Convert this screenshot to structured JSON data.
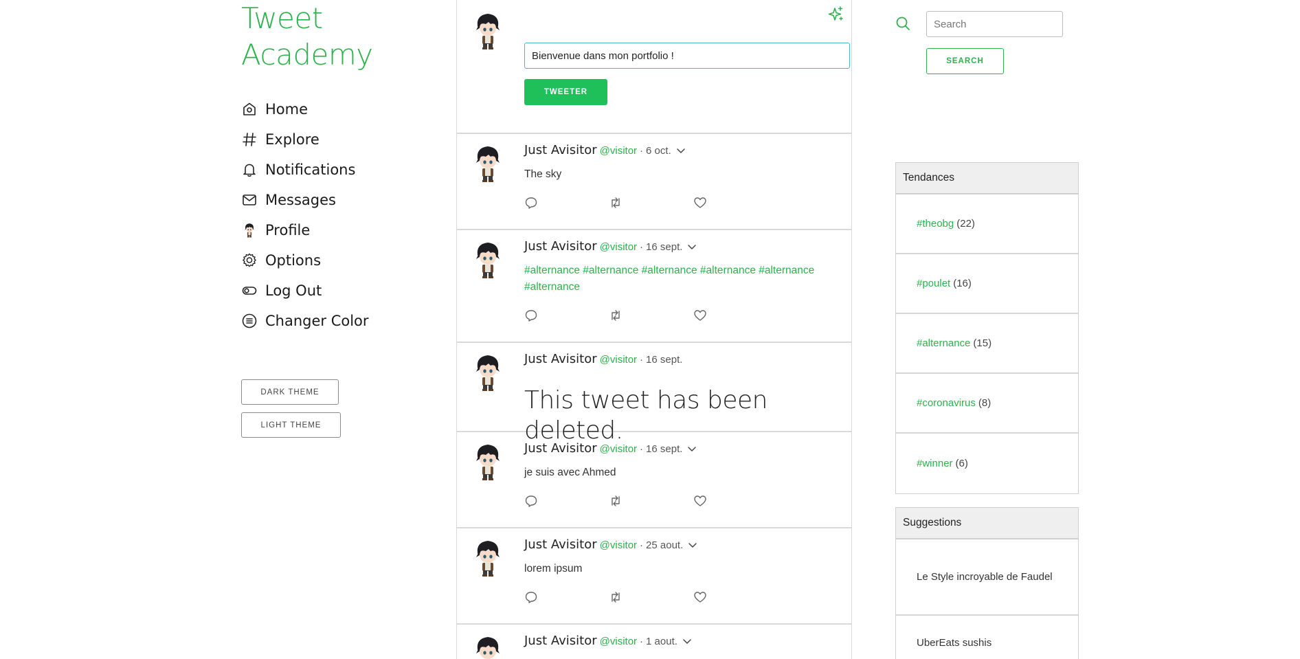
{
  "app": {
    "title_line1": "Tweet",
    "title_line2": "Academy"
  },
  "nav": [
    {
      "label": "Home",
      "icon": "home-icon"
    },
    {
      "label": "Explore",
      "icon": "hashtag-icon"
    },
    {
      "label": "Notifications",
      "icon": "bell-icon"
    },
    {
      "label": "Messages",
      "icon": "envelope-icon"
    },
    {
      "label": "Profile",
      "icon": "avatar-icon"
    },
    {
      "label": "Options",
      "icon": "gear-icon"
    },
    {
      "label": "Log Out",
      "icon": "toggle-icon"
    },
    {
      "label": "Changer Color",
      "icon": "list-circle-icon"
    }
  ],
  "theme": {
    "dark_label": "DARK THEME",
    "light_label": "LIGHT THEME"
  },
  "compose": {
    "value": "Bienvenue dans mon portfolio !",
    "button_label": "TWEETER"
  },
  "tweets": [
    {
      "name": "Just Avisitor",
      "handle": "@visitor",
      "dot": "·",
      "date": "6 oct.",
      "body": "The sky"
    },
    {
      "name": "Just Avisitor",
      "handle": "@visitor",
      "dot": "·",
      "date": "16 sept.",
      "body": "#alternance #alternance #alternance #alternance #alternance #alternance"
    },
    {
      "name": "Just Avisitor",
      "handle": "@visitor",
      "dot": "·",
      "date": "16 sept.",
      "body": "This tweet has been deleted."
    },
    {
      "name": "Just Avisitor",
      "handle": "@visitor",
      "dot": "·",
      "date": "16 sept.",
      "body": "je suis avec Ahmed"
    },
    {
      "name": "Just Avisitor",
      "handle": "@visitor",
      "dot": "·",
      "date": "25 aout.",
      "body": "lorem ipsum"
    },
    {
      "name": "Just Avisitor",
      "handle": "@visitor",
      "dot": "·",
      "date": "1 aout.",
      "body": ""
    }
  ],
  "search": {
    "placeholder": "Search",
    "button_label": "SEARCH"
  },
  "trends": {
    "title": "Tendances",
    "items": [
      {
        "tag": "#theobg",
        "count": "(22)"
      },
      {
        "tag": "#poulet",
        "count": "(16)"
      },
      {
        "tag": "#alternance",
        "count": "(15)"
      },
      {
        "tag": "#coronavirus",
        "count": "(8)"
      },
      {
        "tag": "#winner",
        "count": "(6)"
      }
    ]
  },
  "suggestions": {
    "title": "Suggestions",
    "items": [
      {
        "label": "Le Style incroyable de Faudel"
      },
      {
        "label": "UberEats sushis"
      }
    ]
  },
  "colors": {
    "accent": "#2bb24c",
    "button_green": "#1fbf5a",
    "input_border": "#4db6c4"
  }
}
